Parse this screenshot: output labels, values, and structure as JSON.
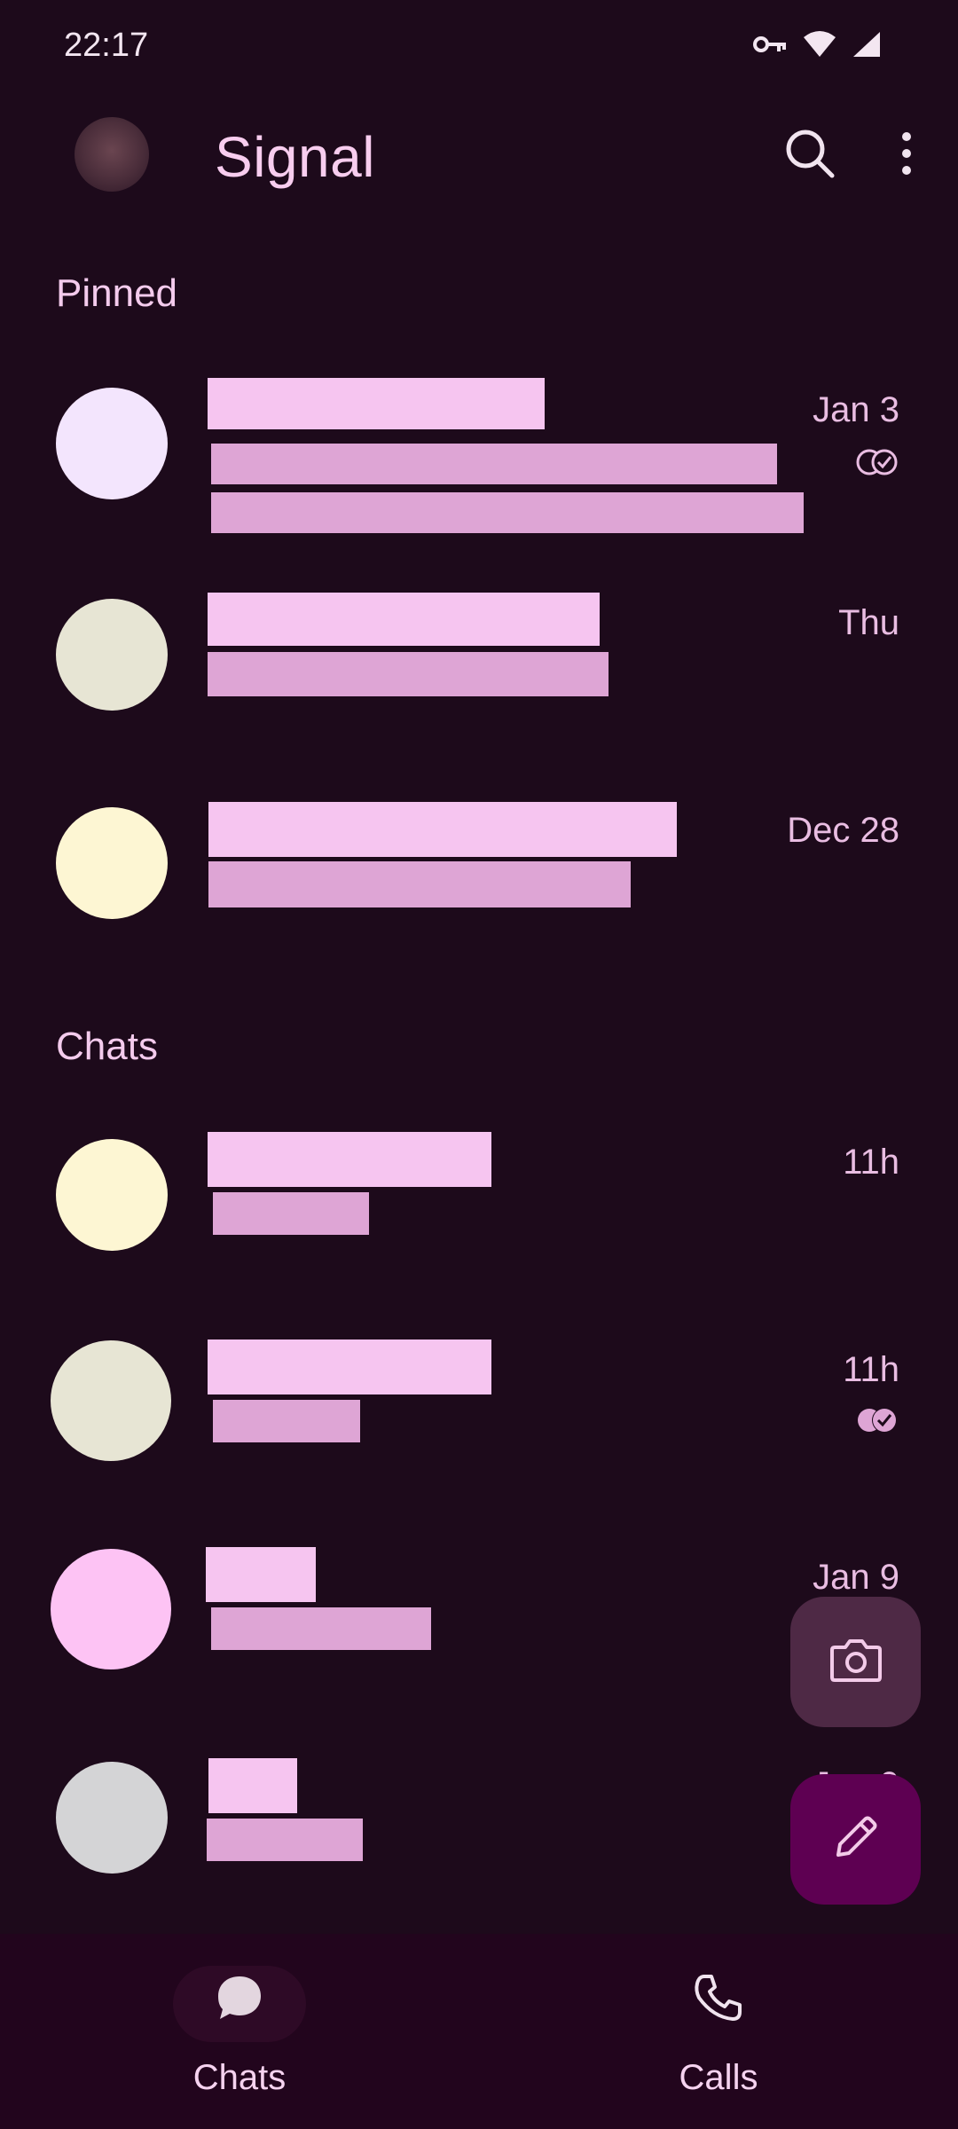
{
  "status_bar": {
    "time": "22:17",
    "icons": [
      "vpn-key-icon",
      "wifi-icon",
      "cell-signal-icon"
    ]
  },
  "app_bar": {
    "title": "Signal",
    "actions": [
      "search-icon",
      "more-vert-icon"
    ]
  },
  "sections": {
    "pinned": "Pinned",
    "chats": "Chats"
  },
  "pinned_chats": [
    {
      "time": "Jan 3",
      "receipt": "delivered",
      "avatar_color": "#f3e5fd"
    },
    {
      "time": "Thu",
      "receipt": "",
      "avatar_color": "#e7e5d4"
    },
    {
      "time": "Dec 28",
      "receipt": "",
      "avatar_color": "#fdf6d3"
    }
  ],
  "chats": [
    {
      "time": "11h",
      "receipt": "",
      "avatar_color": "#fdf6d3"
    },
    {
      "time": "11h",
      "receipt": "read",
      "avatar_color": "#e7e5d4"
    },
    {
      "time": "Jan 9",
      "receipt": "",
      "avatar_color": "#fdc3f4"
    },
    {
      "time": "Jan 9",
      "receipt": "",
      "avatar_color": "#d4d4d6"
    }
  ],
  "fabs": {
    "camera": "camera-icon",
    "compose": "pencil-icon"
  },
  "bottom_nav": {
    "items": [
      {
        "label": "Chats",
        "icon": "chat-bubble-icon",
        "selected": true
      },
      {
        "label": "Calls",
        "icon": "phone-icon",
        "selected": false
      }
    ]
  },
  "colors": {
    "background": "#1d0a1b",
    "accent_text": "#f8cdef",
    "redacted_name": "#f6c5f0",
    "redacted_message": "#dea5d5",
    "fab_camera": "#4e2945",
    "fab_compose": "#5e0052"
  }
}
